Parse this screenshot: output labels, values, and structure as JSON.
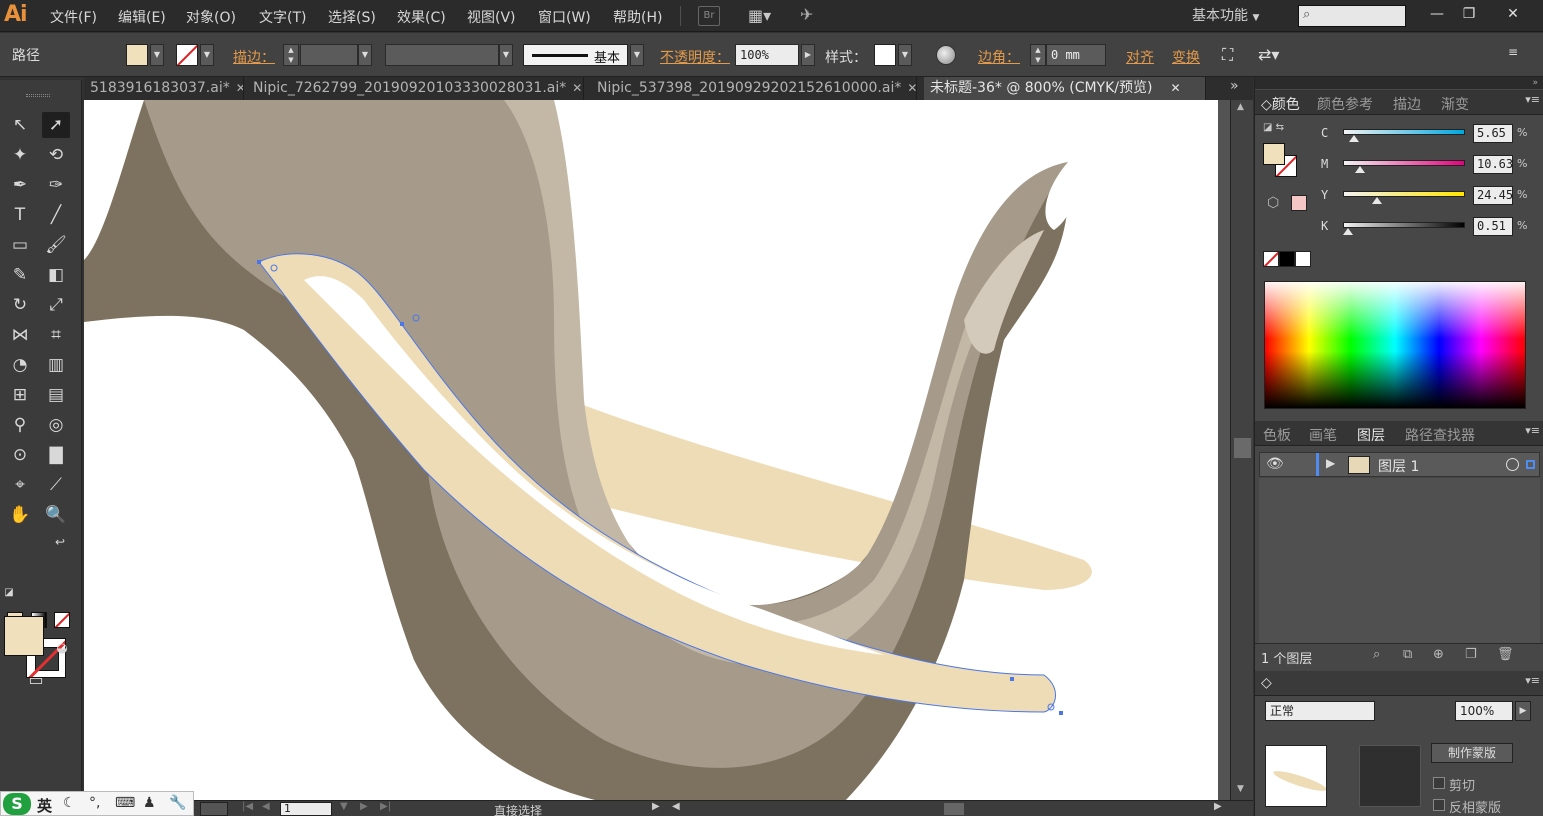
{
  "app": {
    "logo": "Ai",
    "menu": [
      "文件(F)",
      "编辑(E)",
      "对象(O)",
      "文字(T)",
      "选择(S)",
      "效果(C)",
      "视图(V)",
      "窗口(W)",
      "帮助(H)"
    ],
    "bridge_label": "Br",
    "workspace": "基本功能",
    "window_buttons": [
      "—",
      "❐",
      "✕"
    ]
  },
  "control_bar": {
    "selection_type": "路径",
    "fill_color": "#f0e0bc",
    "stroke_label": "描边：",
    "stroke_style_name": "基本",
    "opacity_label": "不透明度：",
    "opacity_value": "100%",
    "style_label": "样式：",
    "corner_label": "边角：",
    "corner_value": "0 mm",
    "align_label": "对齐",
    "transform_label": "变换"
  },
  "tabs": [
    {
      "label": "5183916183037.ai*",
      "active": false
    },
    {
      "label": "Nipic_7262799_20190920103330028031.ai*",
      "active": false
    },
    {
      "label": "Nipic_537398_20190929202152610000.ai*",
      "active": false
    },
    {
      "label": "未标题-36* @ 800% (CMYK/预览)",
      "active": true
    }
  ],
  "tab_close": "✕",
  "tab_overflow": "»",
  "color_panel": {
    "tabs": [
      "颜色",
      "颜色参考",
      "描边",
      "渐变"
    ],
    "channels": [
      {
        "label": "C",
        "value": "5.65",
        "fraction": 0.0565,
        "track_color": "linear-gradient(to right,#f2f2f2,#00a7e0)"
      },
      {
        "label": "M",
        "value": "10.63",
        "fraction": 0.1063,
        "track_color": "linear-gradient(to right,#f2f2f2,#e6007e)"
      },
      {
        "label": "Y",
        "value": "24.45",
        "fraction": 0.2445,
        "track_color": "linear-gradient(to right,#f2f2f2,#ffe500)"
      },
      {
        "label": "K",
        "value": "0.51",
        "fraction": 0.0051,
        "track_color": "linear-gradient(to right,#f2f2f2,#000000)"
      }
    ],
    "percent_sign": "%",
    "out_of_gamut_color": "#f4c6c6"
  },
  "layers_panel": {
    "tabs": [
      "色板",
      "画笔",
      "图层",
      "路径查找器"
    ],
    "layer_name": "图层 1",
    "layer_count": "1 个图层"
  },
  "transparency_panel": {
    "blend_mode": "正常",
    "opacity": "100%",
    "make_mask_button": "制作蒙版",
    "clip_label": "剪切",
    "invert_label": "反相蒙版"
  },
  "status": {
    "page": "1",
    "tool_name": "直接选择"
  },
  "ime": {
    "logo": "S",
    "lang": "英"
  },
  "icons": {
    "selection": "selection-tool-icon",
    "direct_selection": "direct-selection-tool-icon"
  }
}
